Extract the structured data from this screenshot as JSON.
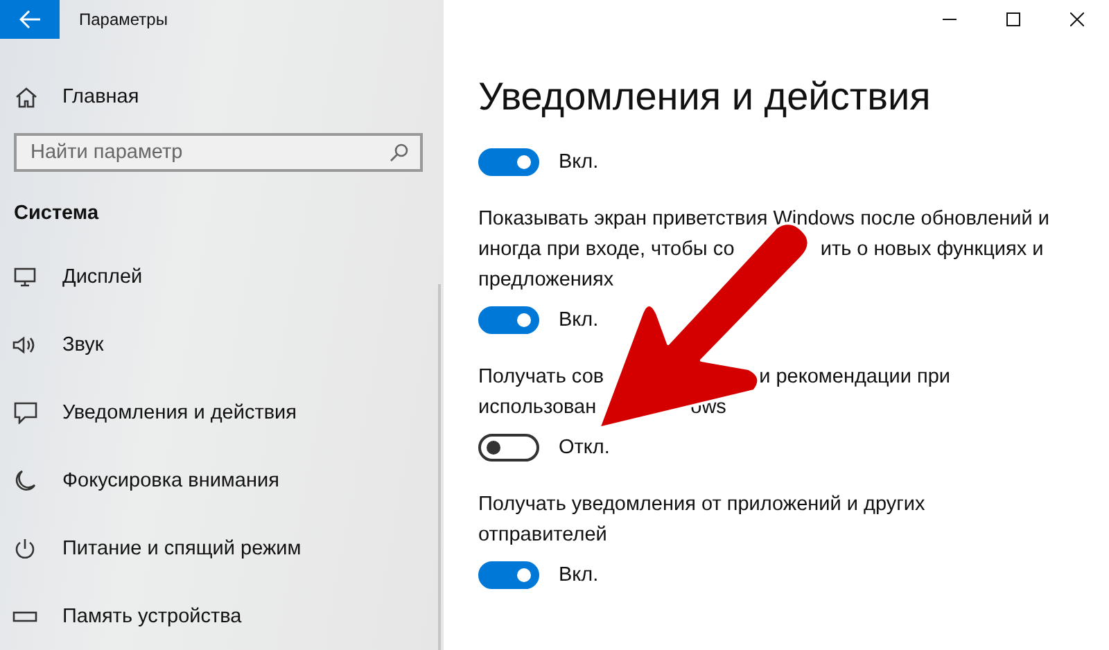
{
  "window": {
    "title": "Параметры"
  },
  "sidebar": {
    "home": "Главная",
    "search": {
      "placeholder": "Найти параметр"
    },
    "section": "Система",
    "items": [
      {
        "label": "Дисплей"
      },
      {
        "label": "Звук"
      },
      {
        "label": "Уведомления и действия"
      },
      {
        "label": "Фокусировка внимания"
      },
      {
        "label": "Питание и спящий режим"
      },
      {
        "label": "Память устройства"
      }
    ]
  },
  "page": {
    "title": "Уведомления и действия",
    "settings": [
      {
        "toggle": {
          "on": true,
          "label": "Вкл."
        }
      },
      {
        "description": [
          [
            "Показывать экран приветствия Windows после обновлений и"
          ],
          [
            "иногда при входе, чтобы со",
            "ить о новых функциях и"
          ],
          [
            "предложениях"
          ]
        ],
        "toggle": {
          "on": true,
          "label": "Вкл."
        }
      },
      {
        "description": [
          [
            "Получать сов",
            "и рекомендации при"
          ],
          [
            "использован",
            "ows"
          ]
        ],
        "toggle": {
          "on": false,
          "label": "Откл."
        }
      },
      {
        "description": [
          [
            "Получать уведомления от приложений и других"
          ],
          [
            "отправителей"
          ]
        ],
        "toggle": {
          "on": true,
          "label": "Вкл."
        }
      }
    ]
  }
}
